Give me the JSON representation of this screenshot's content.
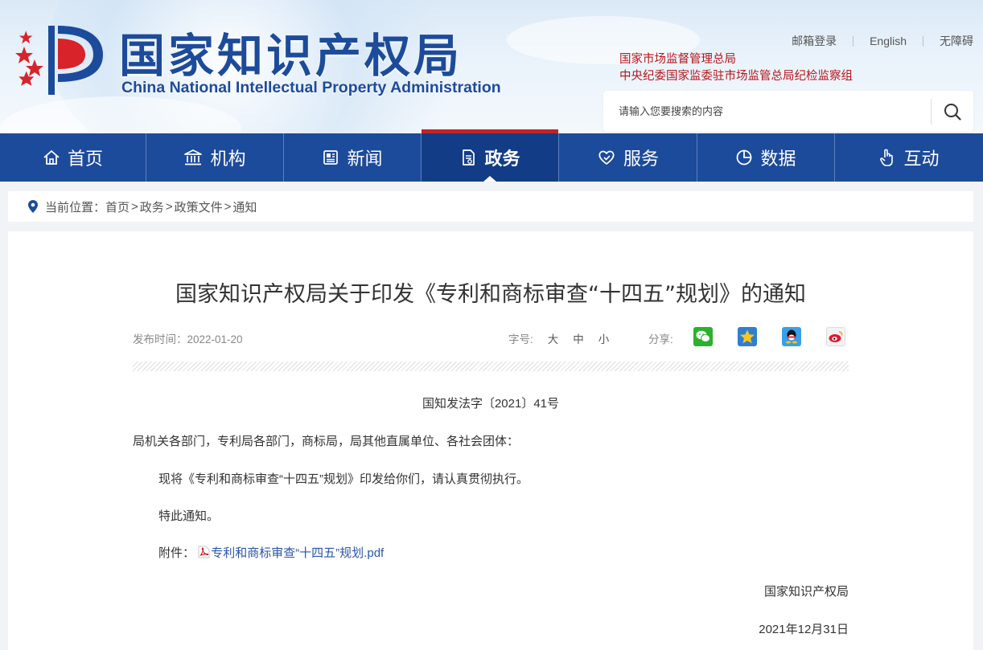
{
  "header": {
    "logo_cn": "国家知识产权局",
    "logo_en": "China National Intellectual Property Administration",
    "top_links": [
      "邮箱登录",
      "English",
      "无障碍"
    ],
    "org_links": [
      "国家市场监督管理总局",
      "中央纪委国家监委驻市场监管总局纪检监察组"
    ],
    "search_placeholder": "请输入您要搜索的内容"
  },
  "nav": {
    "items": [
      {
        "label": "首页",
        "icon": "home-icon"
      },
      {
        "label": "机构",
        "icon": "institution-icon"
      },
      {
        "label": "新闻",
        "icon": "news-icon"
      },
      {
        "label": "政务",
        "icon": "document-icon",
        "active": true
      },
      {
        "label": "服务",
        "icon": "service-heart-icon"
      },
      {
        "label": "数据",
        "icon": "pie-chart-icon"
      },
      {
        "label": "互动",
        "icon": "pointer-hand-icon"
      }
    ]
  },
  "breadcrumb": {
    "prefix": "当前位置：",
    "items": [
      "首页",
      "政务",
      "政策文件",
      "通知"
    ],
    "separator": ">"
  },
  "article": {
    "title": "国家知识产权局关于印发《专利和商标审查“十四五”规划》的通知",
    "publish_label": "发布时间：",
    "publish_date": "2022-01-20",
    "font_size_label": "字号:",
    "font_sizes": [
      "大",
      "中",
      "小"
    ],
    "share_label": "分享:",
    "share_targets": [
      "wechat-icon",
      "qzone-icon",
      "qq-icon",
      "weibo-icon"
    ],
    "doc_number": "国知发法字〔2021〕41号",
    "recipients": "局机关各部门，专利局各部门，商标局，局其他直属单位、各社会团体：",
    "body": "现将《专利和商标审查“十四五”规划》印发给你们，请认真贯彻执行。",
    "closing": "特此通知。",
    "attachment_label": "附件：",
    "attachment_name": "专利和商标审查“十四五”规划.pdf",
    "signature": "国家知识产权局",
    "date": "2021年12月31日"
  },
  "colors": {
    "brand_blue": "#1d4b9b",
    "nav_active": "#123d86",
    "accent_red": "#c0242b",
    "link_blue": "#2a56a6"
  }
}
